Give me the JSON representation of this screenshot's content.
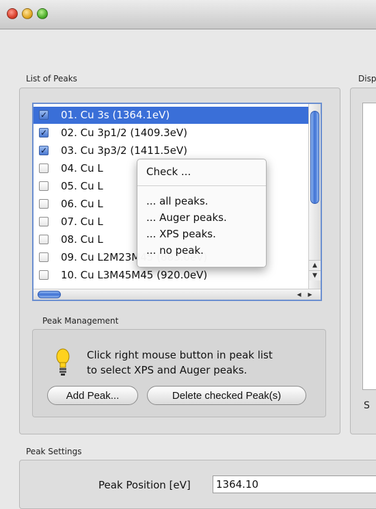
{
  "window": {},
  "list_of_peaks": {
    "section_label": "List of Peaks",
    "items": [
      {
        "checked": true,
        "label": "01. Cu 3s (1364.1eV)",
        "selected": true
      },
      {
        "checked": true,
        "label": "02. Cu 3p1/2 (1409.3eV)",
        "selected": false
      },
      {
        "checked": true,
        "label": "03. Cu 3p3/2 (1411.5eV)",
        "selected": false
      },
      {
        "checked": false,
        "label": "04. Cu L",
        "selected": false
      },
      {
        "checked": false,
        "label": "05. Cu L",
        "selected": false
      },
      {
        "checked": false,
        "label": "06. Cu L",
        "selected": false
      },
      {
        "checked": false,
        "label": "07. Cu L",
        "selected": false
      },
      {
        "checked": false,
        "label": "08. Cu L",
        "selected": false
      },
      {
        "checked": false,
        "label": "09. Cu L2M23M45 (883.0eV)",
        "selected": false
      },
      {
        "checked": false,
        "label": "10. Cu L3M45M45 (920.0eV)",
        "selected": false
      }
    ]
  },
  "context_menu": {
    "header": "Check ...",
    "items": [
      "... all peaks.",
      "... Auger peaks.",
      "... XPS peaks.",
      "... no peak."
    ]
  },
  "peak_management": {
    "section_label": "Peak Management",
    "hint_line1": "Click right mouse button in peak list",
    "hint_line2": "to select XPS and Auger peaks.",
    "add_label": "Add Peak...",
    "delete_label": "Delete checked Peak(s)"
  },
  "display": {
    "section_label": "Disp",
    "lower_label": "S"
  },
  "peak_settings": {
    "section_label": "Peak Settings",
    "position_label": "Peak Position [eV]",
    "position_value": "1364.10"
  },
  "icons": {
    "hint": "lightbulb-icon",
    "checkbox_checked": "checkmark-icon"
  },
  "colors": {
    "selection": "#3a6fd8",
    "scroll_thumb": "#3f72d4",
    "bulb": "#ffd21e"
  }
}
